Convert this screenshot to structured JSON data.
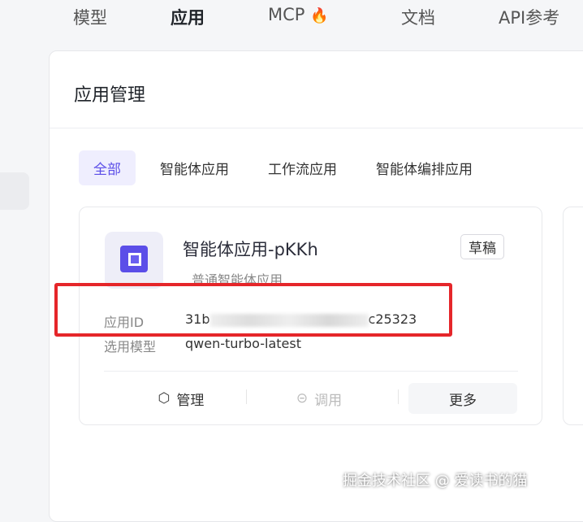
{
  "nav": {
    "items": [
      "模型",
      "应用",
      "MCP",
      "文档",
      "API参考"
    ],
    "fire_icon": "🔥"
  },
  "page": {
    "title": "应用管理"
  },
  "tabs": [
    "全部",
    "智能体应用",
    "工作流应用",
    "智能体编排应用"
  ],
  "card": {
    "name": "智能体应用-pKKh",
    "type": "普通智能体应用",
    "status": "草稿",
    "id_label": "应用ID",
    "id_prefix": "31b",
    "id_suffix": "c25323",
    "model_label": "选用模型",
    "model_value": "qwen-turbo-latest",
    "actions": {
      "manage": "管理",
      "invoke": "调用",
      "more": "更多"
    }
  },
  "watermark": "掘金技术社区 @ 爱读书的猫"
}
